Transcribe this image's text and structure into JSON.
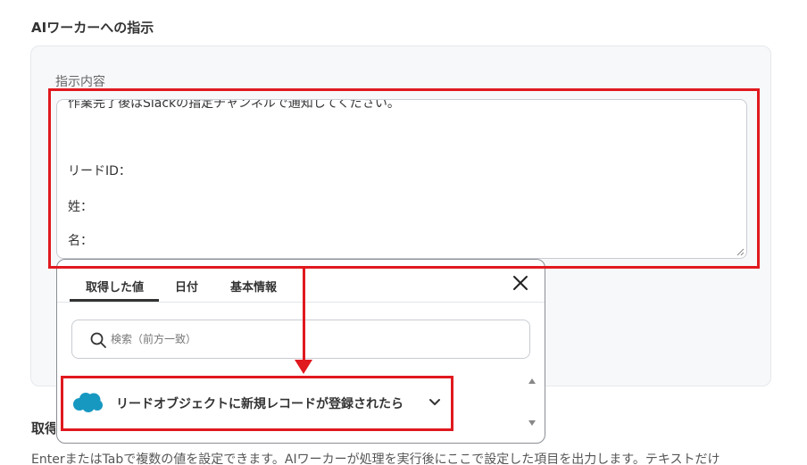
{
  "section": {
    "title": "AIワーカーへの指示"
  },
  "instructions": {
    "label": "指示内容",
    "lines": [
      "作業完了後はSlackの指定チャンネルで通知してください。",
      "リードID：",
      "姓：",
      "名："
    ]
  },
  "popup": {
    "tabs": [
      {
        "label": "取得した値",
        "active": true
      },
      {
        "label": "日付"
      },
      {
        "label": "基本情報"
      }
    ],
    "search": {
      "placeholder": "検索（前方一致）",
      "value": ""
    },
    "items": [
      {
        "label": "リードオブジェクトに新規レコードが登録されたら",
        "icon": "salesforce-cloud-icon"
      }
    ]
  },
  "next_section": {
    "title": "取得"
  },
  "help": {
    "text": "EnterまたはTabで複数の値を設定できます。AIワーカーが処理を実行後にここで設定した項目を出力します。テキストだけ"
  },
  "colors": {
    "highlight": "#e0191f",
    "salesforce": "#1798c1"
  }
}
